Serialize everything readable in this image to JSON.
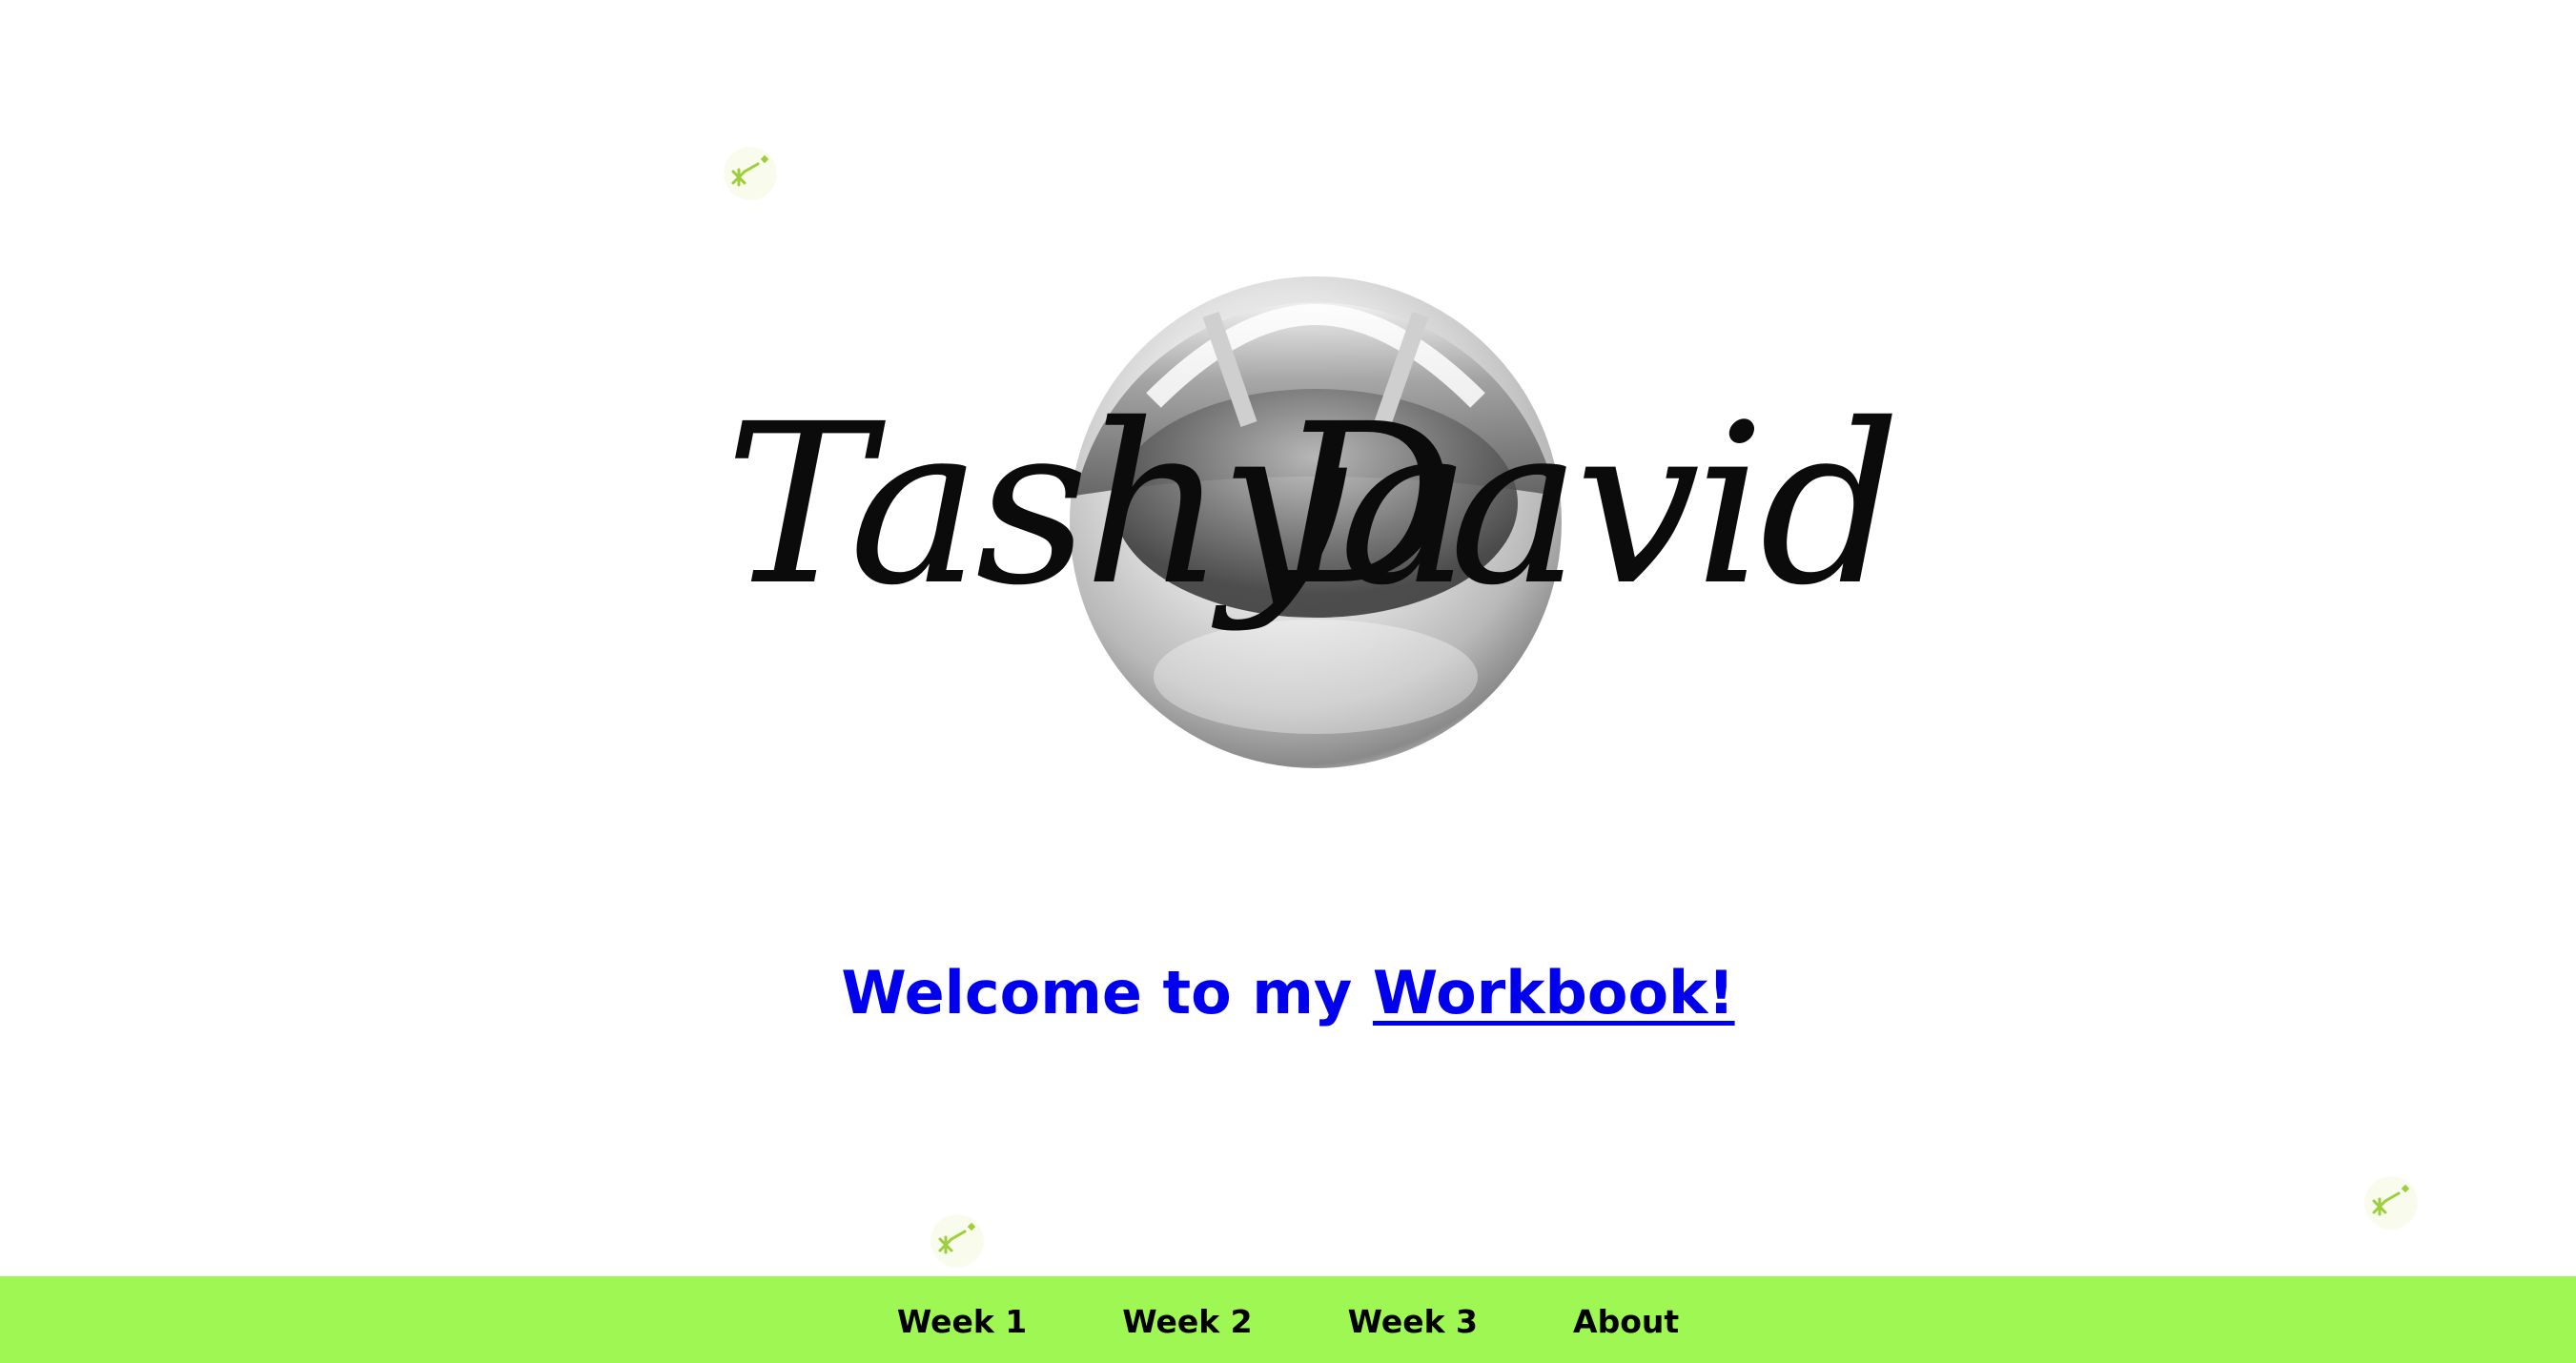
{
  "hero": {
    "first_name": "Tashya",
    "last_name": "David"
  },
  "welcome": {
    "prefix": "Welcome to my ",
    "link_text": "Workbook!"
  },
  "nav": {
    "items": [
      {
        "label": "Week 1"
      },
      {
        "label": "Week 2"
      },
      {
        "label": "Week 3"
      },
      {
        "label": "About"
      }
    ]
  },
  "colors": {
    "accent_green": "#9ef752",
    "link_blue": "#0000ee",
    "sparkle_green": "#9ccf3a"
  },
  "icons": {
    "decor": "sparkle-icon",
    "hero": "chrome-sphere-icon"
  }
}
